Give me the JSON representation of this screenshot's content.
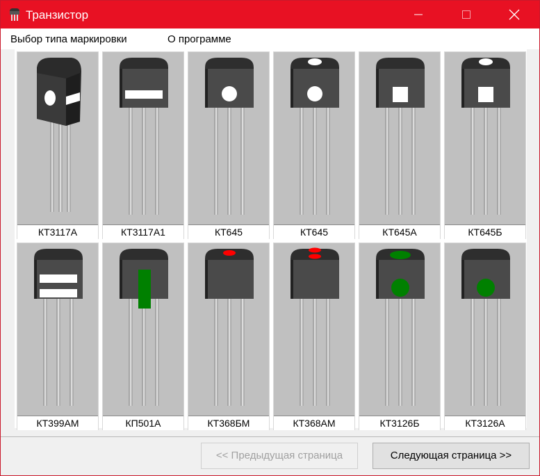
{
  "window": {
    "title": "Транзистор"
  },
  "menu": [
    "Выбор типа маркировки",
    "О программе"
  ],
  "transistors": [
    {
      "label": "КТ3117А",
      "style": "angled",
      "marks": "dot-and-band"
    },
    {
      "label": "КТ3117А1",
      "style": "front",
      "marks": "white-bar"
    },
    {
      "label": "КТ645",
      "style": "front",
      "marks": "white-dot"
    },
    {
      "label": "КТ645",
      "style": "front",
      "marks": "white-top-oval + white-dot"
    },
    {
      "label": "КТ645А",
      "style": "front",
      "marks": "white-square"
    },
    {
      "label": "КТ645Б",
      "style": "front",
      "marks": "white-top-oval + white-square"
    },
    {
      "label": "КТ399АМ",
      "style": "front",
      "marks": "two-white-bars"
    },
    {
      "label": "КП501А",
      "style": "front",
      "marks": "green-vertical-bar"
    },
    {
      "label": "КТ368БМ",
      "style": "front",
      "marks": "red-top-oval"
    },
    {
      "label": "КТ368АМ",
      "style": "front",
      "marks": "two-red-top-ovals"
    },
    {
      "label": "КТ3126Б",
      "style": "front",
      "marks": "green-top-oval + green-dot"
    },
    {
      "label": "КТ3126А",
      "style": "front",
      "marks": "green-dot"
    }
  ],
  "buttons": {
    "prev": "<< Предыдущая страница",
    "next": "Следующая страница >>"
  },
  "colors": {
    "titlebar": "#e81123",
    "body": "#4a4a4a",
    "red_mark": "#ff0000",
    "green_mark": "#008000",
    "white_mark": "#ffffff"
  }
}
